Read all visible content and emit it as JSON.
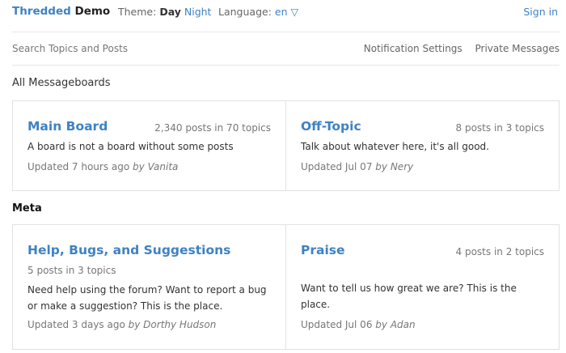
{
  "header": {
    "brand_primary": "Thredded",
    "brand_secondary": "Demo",
    "theme_label": "Theme:",
    "theme_day": "Day",
    "theme_night": "Night",
    "language_label": "Language:",
    "language_value": "en ▽",
    "sign_in": "Sign in"
  },
  "nav": {
    "search_placeholder": "Search Topics and Posts",
    "notification_settings": "Notification Settings",
    "private_messages": "Private Messages"
  },
  "groups": [
    {
      "title": "All Messageboards",
      "boards": [
        {
          "name": "Main Board",
          "stats": "2,340 posts in 70 topics",
          "description": "A board is not a board without some posts",
          "updated": "Updated 7 hours ago",
          "by_label": "by",
          "by": "Vanita"
        },
        {
          "name": "Off-Topic",
          "stats": "8 posts in 3 topics",
          "description": "Talk about whatever here, it's all good.",
          "updated": "Updated Jul 07",
          "by_label": "by",
          "by": "Nery"
        }
      ]
    },
    {
      "title": "Meta",
      "boards": [
        {
          "name": "Help, Bugs, and Suggestions",
          "stats": "5 posts in 3 topics",
          "description": "Need help using the forum? Want to report a bug or make a suggestion? This is the place.",
          "updated": "Updated 3 days ago",
          "by_label": "by",
          "by": "Dorthy Hudson"
        },
        {
          "name": "Praise",
          "stats": "4 posts in 2 topics",
          "description": "Want to tell us how great we are? This is the place.",
          "updated": "Updated Jul 06",
          "by_label": "by",
          "by": "Adan"
        }
      ]
    }
  ]
}
